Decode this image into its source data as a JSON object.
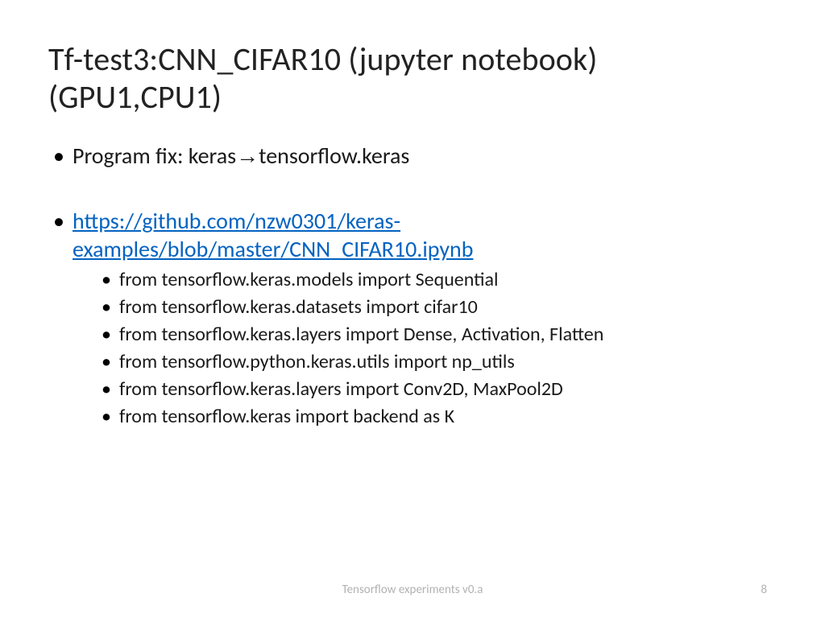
{
  "title": "Tf-test3:CNN_CIFAR10 (jupyter notebook) (GPU1,CPU1)",
  "bullets": {
    "b1_pre": "Program fix: keras",
    "b1_arrow": "→",
    "b1_post": "tensorflow.keras",
    "link": "https://github.com/nzw0301/keras-examples/blob/master/CNN_CIFAR10.ipynb",
    "sub": [
      "from tensorflow.keras.models import Sequential",
      "from tensorflow.keras.datasets import cifar10",
      "from tensorflow.keras.layers import Dense, Activation, Flatten",
      "from tensorflow.python.keras.utils import np_utils",
      "from tensorflow.keras.layers import Conv2D, MaxPool2D",
      "from tensorflow.keras import backend as K"
    ]
  },
  "footer": "Tensorflow experiments v0.a",
  "page": "8"
}
